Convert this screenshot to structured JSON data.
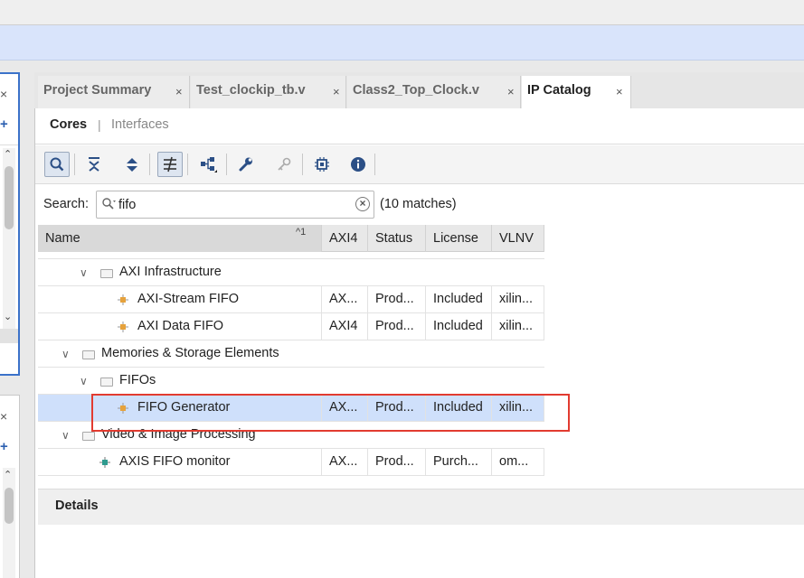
{
  "tabs": [
    {
      "label": "Project Summary",
      "active": false
    },
    {
      "label": "Test_clockip_tb.v",
      "active": false
    },
    {
      "label": "Class2_Top_Clock.v",
      "active": false
    },
    {
      "label": "IP Catalog",
      "active": true
    }
  ],
  "tab_close_glyph": "×",
  "subtabs": {
    "cores": "Cores",
    "separator": "|",
    "interfaces": "Interfaces"
  },
  "toolbar_icons": [
    "search-icon",
    "collapse-all-icon",
    "expand-all-icon",
    "filter-icon",
    "hierarchy-icon",
    "wrench-icon",
    "key-icon",
    "chip-icon",
    "info-icon"
  ],
  "search": {
    "label": "Search:",
    "value": "fifo",
    "match_count": "(10 matches)"
  },
  "columns": {
    "name": "Name",
    "sort_indicator": "^1",
    "axi4": "AXI4",
    "status": "Status",
    "license": "License",
    "vlnv": "VLNV"
  },
  "rows": [
    {
      "name": "AXI Infrastructure",
      "type": "folder",
      "level": 1,
      "axi4": "",
      "status": "",
      "license": "",
      "vlnv": ""
    },
    {
      "name": "AXI-Stream FIFO",
      "type": "ip",
      "level": 2,
      "axi4": "AX...",
      "status": "Prod...",
      "license": "Included",
      "vlnv": "xilin..."
    },
    {
      "name": "AXI Data FIFO",
      "type": "ip",
      "level": 2,
      "axi4": "AXI4",
      "status": "Prod...",
      "license": "Included",
      "vlnv": "xilin..."
    },
    {
      "name": "Memories & Storage Elements",
      "type": "folder",
      "level": 0,
      "axi4": "",
      "status": "",
      "license": "",
      "vlnv": ""
    },
    {
      "name": "FIFOs",
      "type": "folder",
      "level": 1,
      "axi4": "",
      "status": "",
      "license": "",
      "vlnv": ""
    },
    {
      "name": "FIFO Generator",
      "type": "ip",
      "level": 2,
      "selected": true,
      "axi4": "AX...",
      "status": "Prod...",
      "license": "Included",
      "vlnv": "xilin..."
    },
    {
      "name": "Video & Image Processing",
      "type": "folder",
      "level": 0,
      "axi4": "",
      "status": "",
      "license": "",
      "vlnv": ""
    },
    {
      "name": "AXIS FIFO monitor",
      "type": "ip-thirdparty",
      "level": 1,
      "axi4": "AX...",
      "status": "Prod...",
      "license": "Purch...",
      "vlnv": "om..."
    }
  ],
  "details": {
    "label": "Details"
  },
  "colors": {
    "highlight_border": "#e23b30",
    "selected_row": "#cfe0fb",
    "banner": "#d9e4fb",
    "active_panel_border": "#3b72c9"
  }
}
